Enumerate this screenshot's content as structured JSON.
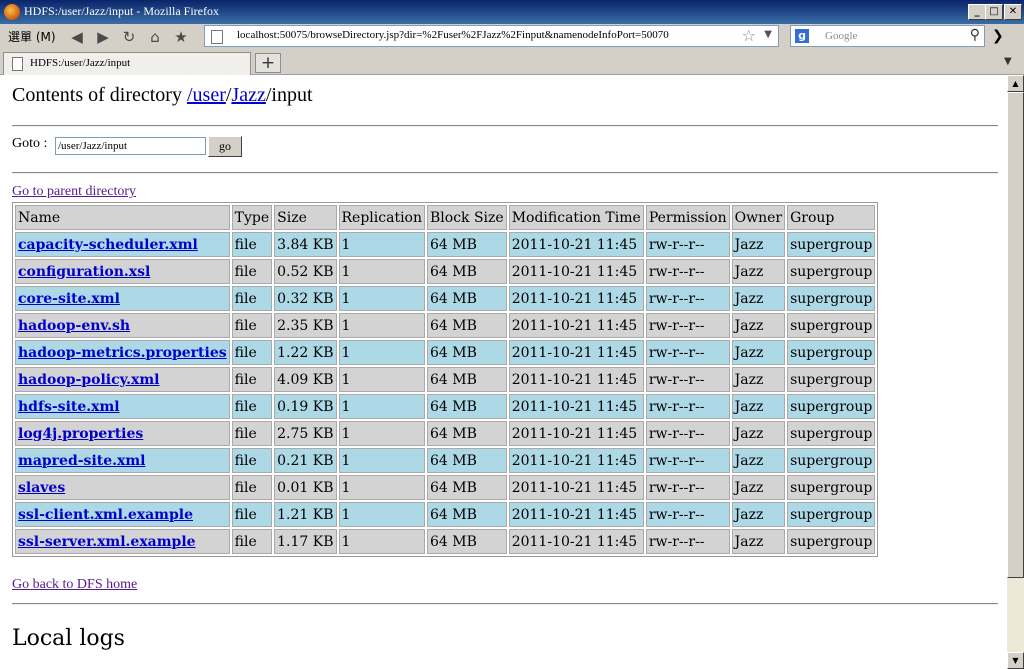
{
  "window": {
    "title": "HDFS:/user/Jazz/input - Mozilla Firefox",
    "min_glyph": "_",
    "max_glyph": "□",
    "close_glyph": "✕"
  },
  "toolbar": {
    "menu_label": "選單 (M)",
    "url": "localhost:50075/browseDirectory.jsp?dir=%2Fuser%2FJazz%2Finput&namenodeInfoPort=50070",
    "search_placeholder": "Google",
    "back_icon": "◀",
    "forward_icon": "▶",
    "reload_icon": "↻",
    "home_icon": "⌂",
    "bookmark_icon": "★",
    "star_icon": "☆",
    "dropdown_icon": "▼",
    "search_icon": "⚲",
    "more_icon": "❯"
  },
  "tabs": [
    {
      "label": "HDFS:/user/Jazz/input"
    }
  ],
  "newtab_glyph": "+",
  "page": {
    "heading_prefix": "Contents of directory ",
    "breadcrumb": [
      {
        "sep": "/",
        "link": "user"
      },
      {
        "sep": "/",
        "link": "Jazz"
      },
      {
        "sep": "/",
        "text": "input"
      }
    ],
    "goto_label": "Goto : ",
    "goto_value": "/user/Jazz/input",
    "go_button": "go",
    "parent_link": "Go to parent directory",
    "dfs_home_link": "Go back to DFS home",
    "local_logs_heading": "Local logs"
  },
  "table": {
    "columns": [
      "Name",
      "Type",
      "Size",
      "Replication",
      "Block Size",
      "Modification Time",
      "Permission",
      "Owner",
      "Group"
    ],
    "rows": [
      [
        "capacity-scheduler.xml",
        "file",
        "3.84 KB",
        "1",
        "64 MB",
        "2011-10-21 11:45",
        "rw-r--r--",
        "Jazz",
        "supergroup"
      ],
      [
        "configuration.xsl",
        "file",
        "0.52 KB",
        "1",
        "64 MB",
        "2011-10-21 11:45",
        "rw-r--r--",
        "Jazz",
        "supergroup"
      ],
      [
        "core-site.xml",
        "file",
        "0.32 KB",
        "1",
        "64 MB",
        "2011-10-21 11:45",
        "rw-r--r--",
        "Jazz",
        "supergroup"
      ],
      [
        "hadoop-env.sh",
        "file",
        "2.35 KB",
        "1",
        "64 MB",
        "2011-10-21 11:45",
        "rw-r--r--",
        "Jazz",
        "supergroup"
      ],
      [
        "hadoop-metrics.properties",
        "file",
        "1.22 KB",
        "1",
        "64 MB",
        "2011-10-21 11:45",
        "rw-r--r--",
        "Jazz",
        "supergroup"
      ],
      [
        "hadoop-policy.xml",
        "file",
        "4.09 KB",
        "1",
        "64 MB",
        "2011-10-21 11:45",
        "rw-r--r--",
        "Jazz",
        "supergroup"
      ],
      [
        "hdfs-site.xml",
        "file",
        "0.19 KB",
        "1",
        "64 MB",
        "2011-10-21 11:45",
        "rw-r--r--",
        "Jazz",
        "supergroup"
      ],
      [
        "log4j.properties",
        "file",
        "2.75 KB",
        "1",
        "64 MB",
        "2011-10-21 11:45",
        "rw-r--r--",
        "Jazz",
        "supergroup"
      ],
      [
        "mapred-site.xml",
        "file",
        "0.21 KB",
        "1",
        "64 MB",
        "2011-10-21 11:45",
        "rw-r--r--",
        "Jazz",
        "supergroup"
      ],
      [
        "slaves",
        "file",
        "0.01 KB",
        "1",
        "64 MB",
        "2011-10-21 11:45",
        "rw-r--r--",
        "Jazz",
        "supergroup"
      ],
      [
        "ssl-client.xml.example",
        "file",
        "1.21 KB",
        "1",
        "64 MB",
        "2011-10-21 11:45",
        "rw-r--r--",
        "Jazz",
        "supergroup"
      ],
      [
        "ssl-server.xml.example",
        "file",
        "1.17 KB",
        "1",
        "64 MB",
        "2011-10-21 11:45",
        "rw-r--r--",
        "Jazz",
        "supergroup"
      ]
    ]
  },
  "colors": {
    "row_blue": "#add8e6",
    "row_gray": "#d3d3d3",
    "link": "#0000cc",
    "visited_link": "#551a8b"
  }
}
